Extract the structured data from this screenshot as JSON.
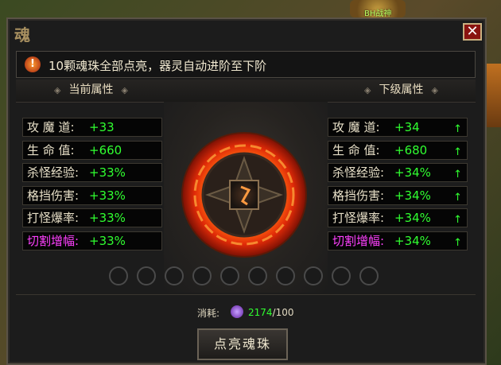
{
  "background": {
    "character_label": "BH战神"
  },
  "window": {
    "logo_glyph": "魂",
    "close_glyph": "✕"
  },
  "notice": {
    "icon_glyph": "!",
    "text": "10颗魂珠全部点亮，器灵自动进阶至下阶"
  },
  "headers": {
    "current": "当前属性",
    "next": "下级属性",
    "diamond": "◈"
  },
  "current_stats": [
    {
      "label": "攻 魔 道:",
      "value": "+33"
    },
    {
      "label": "生 命 值:",
      "value": "+660"
    },
    {
      "label": "杀怪经验:",
      "value": "+33%"
    },
    {
      "label": "格挡伤害:",
      "value": "+33%"
    },
    {
      "label": "打怪爆率:",
      "value": "+33%"
    },
    {
      "label": "切割增幅:",
      "value": "+33%"
    }
  ],
  "next_stats": [
    {
      "label": "攻 魔 道:",
      "value": "+34",
      "arrow": "↑"
    },
    {
      "label": "生 命 值:",
      "value": "+680",
      "arrow": "↑"
    },
    {
      "label": "杀怪经验:",
      "value": "+34%",
      "arrow": "↑"
    },
    {
      "label": "格挡伤害:",
      "value": "+34%",
      "arrow": "↑"
    },
    {
      "label": "打怪爆率:",
      "value": "+34%",
      "arrow": "↑"
    },
    {
      "label": "切割增幅:",
      "value": "+34%",
      "arrow": "↑"
    }
  ],
  "soul_beads": {
    "total": 10,
    "lit": 0
  },
  "cost": {
    "label": "消耗:",
    "have": "2174",
    "separator": "/",
    "need": "100"
  },
  "action": {
    "label": "点亮魂珠"
  },
  "colors": {
    "positive": "#30ff30",
    "special_label": "#ff40ff",
    "close": "#8a1410"
  }
}
